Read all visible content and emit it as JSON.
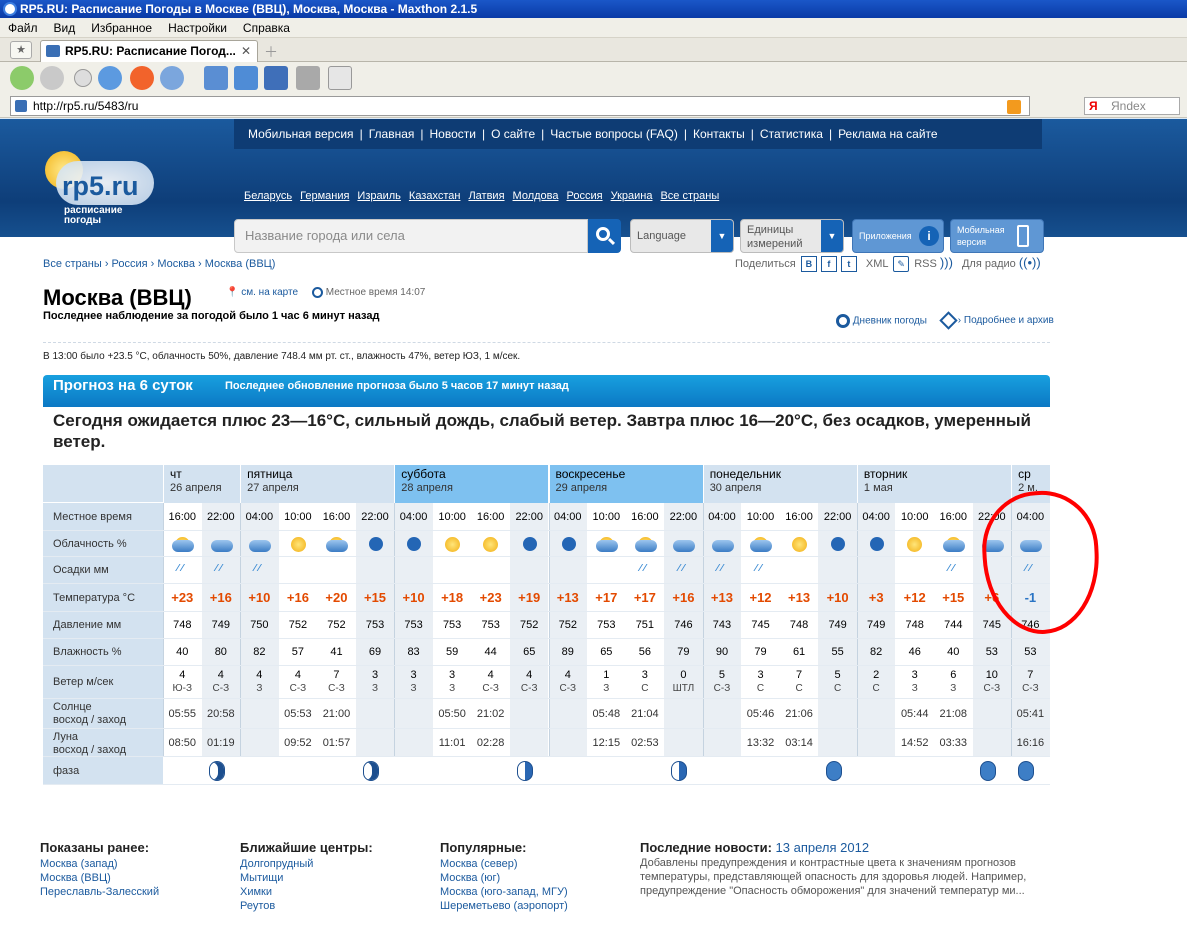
{
  "window_title": "RP5.RU: Расписание Погоды в Москве (ВВЦ), Москва, Москва - Maxthon 2.1.5",
  "menu": [
    "Файл",
    "Вид",
    "Избранное",
    "Настройки",
    "Справка"
  ],
  "tab_title": "RP5.RU: Расписание Погод...",
  "address": "http://rp5.ru/5483/ru",
  "yandex_placeholder": "Яndex",
  "logo": {
    "name": "rp5.ru",
    "sub": "расписание погоды"
  },
  "topnav": [
    "Мобильная версия",
    "Главная",
    "Новости",
    "О сайте",
    "Частые вопросы (FAQ)",
    "Контакты",
    "Статистика",
    "Реклама на сайте"
  ],
  "countries": [
    "Беларусь",
    "Германия",
    "Израиль",
    "Казахстан",
    "Латвия",
    "Молдова",
    "Россия",
    "Украина",
    "Все страны"
  ],
  "search_placeholder": "Название города или села",
  "language_label": "Language",
  "units_label": "Единицы измерений",
  "apps_label": "Приложения",
  "mobile_label": "Мобильная версия",
  "breadcrumb": "Все страны › Россия › Москва › Москва (ВВЦ)",
  "share": {
    "label": "Поделиться",
    "xml": "XML",
    "rss": "RSS",
    "radio": "Для радио"
  },
  "city": "Москва (ВВЦ)",
  "map_link": "см. на карте",
  "local_time": "Местное время  14:07",
  "last_obs": "Последнее наблюдение за погодой было 1 час 6 минут назад",
  "diary": "Дневник погоды",
  "archive": "Подробнее и архив",
  "obs_line": "В 13:00 было +23.5 °C,  облачность 50%,   давление 748.4 мм рт. ст.,    влажность 47%, ветер ЮЗ, 1 м/сек.",
  "forecast": {
    "title": "Прогноз на 6 суток",
    "updated": "Последнее обновление прогноза было 5 часов 17 минут назад",
    "summary": "Сегодня ожидается плюс 23—16°C,  сильный дождь, слабый ветер. Завтра плюс 16—20°C,  без осадков, умеренный ветер."
  },
  "row_labels": {
    "time": "Местное время",
    "cloud": "Облачность %",
    "precip": "Осадки мм",
    "temp": "Температура °C",
    "pressure": "Давление мм",
    "humidity": "Влажность %",
    "wind": "Ветер м/сек",
    "sun": "Солнце\nвосход / заход",
    "moon": "Луна\nвосход / заход",
    "phase": "фаза"
  },
  "days": [
    {
      "name": "чт",
      "date": "26 апреля",
      "highlight": false
    },
    {
      "name": "пятница",
      "date": "27 апреля",
      "highlight": false
    },
    {
      "name": "суббота",
      "date": "28 апреля",
      "highlight": true
    },
    {
      "name": "воскресенье",
      "date": "29 апреля",
      "highlight": true
    },
    {
      "name": "понедельник",
      "date": "30 апреля",
      "highlight": false
    },
    {
      "name": "вторник",
      "date": "1 мая",
      "highlight": false
    },
    {
      "name": "ср",
      "date": "2 м.",
      "highlight": false
    }
  ],
  "columns": [
    {
      "day": 0,
      "time": "16:00",
      "temp": "+23",
      "p": "748",
      "h": "40",
      "w": "4",
      "wd": "Ю-З",
      "sky": "cloud",
      "rain": true,
      "night": false
    },
    {
      "day": 0,
      "time": "22:00",
      "temp": "+16",
      "p": "749",
      "h": "80",
      "w": "4",
      "wd": "С-З",
      "sky": "cloud",
      "rain": true,
      "night": true
    },
    {
      "day": 1,
      "time": "04:00",
      "temp": "+10",
      "p": "750",
      "h": "82",
      "w": "4",
      "wd": "З",
      "sky": "cloud",
      "rain": true,
      "night": true
    },
    {
      "day": 1,
      "time": "10:00",
      "temp": "+16",
      "p": "752",
      "h": "57",
      "w": "4",
      "wd": "С-З",
      "sky": "sun",
      "rain": false,
      "night": false
    },
    {
      "day": 1,
      "time": "16:00",
      "temp": "+20",
      "p": "752",
      "h": "41",
      "w": "7",
      "wd": "С-З",
      "sky": "cloud",
      "rain": false,
      "night": false
    },
    {
      "day": 1,
      "time": "22:00",
      "temp": "+15",
      "p": "753",
      "h": "69",
      "w": "3",
      "wd": "З",
      "sky": "moon",
      "rain": false,
      "night": true
    },
    {
      "day": 2,
      "time": "04:00",
      "temp": "+10",
      "p": "753",
      "h": "83",
      "w": "3",
      "wd": "З",
      "sky": "moon",
      "rain": false,
      "night": true
    },
    {
      "day": 2,
      "time": "10:00",
      "temp": "+18",
      "p": "753",
      "h": "59",
      "w": "3",
      "wd": "З",
      "sky": "sun",
      "rain": false,
      "night": false
    },
    {
      "day": 2,
      "time": "16:00",
      "temp": "+23",
      "p": "753",
      "h": "44",
      "w": "4",
      "wd": "С-З",
      "sky": "sun",
      "rain": false,
      "night": false
    },
    {
      "day": 2,
      "time": "22:00",
      "temp": "+19",
      "p": "752",
      "h": "65",
      "w": "4",
      "wd": "С-З",
      "sky": "moon",
      "rain": false,
      "night": true
    },
    {
      "day": 3,
      "time": "04:00",
      "temp": "+13",
      "p": "752",
      "h": "89",
      "w": "4",
      "wd": "С-З",
      "sky": "moon",
      "rain": false,
      "night": true
    },
    {
      "day": 3,
      "time": "10:00",
      "temp": "+17",
      "p": "753",
      "h": "65",
      "w": "1",
      "wd": "З",
      "sky": "cloud",
      "rain": false,
      "night": false
    },
    {
      "day": 3,
      "time": "16:00",
      "temp": "+17",
      "p": "751",
      "h": "56",
      "w": "3",
      "wd": "С",
      "sky": "cloud",
      "rain": true,
      "night": false
    },
    {
      "day": 3,
      "time": "22:00",
      "temp": "+16",
      "p": "746",
      "h": "79",
      "w": "0",
      "wd": "ШТЛ",
      "sky": "cloud",
      "rain": true,
      "night": true
    },
    {
      "day": 4,
      "time": "04:00",
      "temp": "+13",
      "p": "743",
      "h": "90",
      "w": "5",
      "wd": "С-З",
      "sky": "cloud",
      "rain": true,
      "night": true
    },
    {
      "day": 4,
      "time": "10:00",
      "temp": "+12",
      "p": "745",
      "h": "79",
      "w": "3",
      "wd": "С",
      "sky": "cloud",
      "rain": true,
      "night": false
    },
    {
      "day": 4,
      "time": "16:00",
      "temp": "+13",
      "p": "748",
      "h": "61",
      "w": "7",
      "wd": "С",
      "sky": "sun",
      "rain": false,
      "night": false
    },
    {
      "day": 4,
      "time": "22:00",
      "temp": "+10",
      "p": "749",
      "h": "55",
      "w": "5",
      "wd": "С",
      "sky": "moon",
      "rain": false,
      "night": true
    },
    {
      "day": 5,
      "time": "04:00",
      "temp": "+3",
      "p": "749",
      "h": "82",
      "w": "2",
      "wd": "С",
      "sky": "moon",
      "rain": false,
      "night": true
    },
    {
      "day": 5,
      "time": "10:00",
      "temp": "+12",
      "p": "748",
      "h": "46",
      "w": "3",
      "wd": "З",
      "sky": "sun",
      "rain": false,
      "night": false
    },
    {
      "day": 5,
      "time": "16:00",
      "temp": "+15",
      "p": "744",
      "h": "40",
      "w": "6",
      "wd": "З",
      "sky": "cloud",
      "rain": true,
      "night": false
    },
    {
      "day": 5,
      "time": "22:00",
      "temp": "+6",
      "p": "745",
      "h": "53",
      "w": "10",
      "wd": "С-З",
      "sky": "cloud",
      "rain": false,
      "night": true
    },
    {
      "day": 6,
      "time": "04:00",
      "temp": "-1",
      "p": "746",
      "h": "53",
      "w": "7",
      "wd": "С-З",
      "sky": "cloud",
      "rain": true,
      "night": true
    }
  ],
  "sun": [
    [
      "05:55",
      "20:58"
    ],
    [
      "05:53",
      "21:00"
    ],
    [
      "05:50",
      "21:02"
    ],
    [
      "05:48",
      "21:04"
    ],
    [
      "05:46",
      "21:06"
    ],
    [
      "05:44",
      "21:08"
    ],
    [
      "05:41",
      ""
    ]
  ],
  "moon": [
    [
      "08:50",
      "01:19"
    ],
    [
      "09:52",
      "01:57"
    ],
    [
      "11:01",
      "02:28"
    ],
    [
      "12:15",
      "02:53"
    ],
    [
      "13:32",
      "03:14"
    ],
    [
      "14:52",
      "03:33"
    ],
    [
      "16:16",
      ""
    ]
  ],
  "phases": [
    "waxing-crescent",
    "waxing-crescent",
    "first-quarter",
    "first-quarter",
    "waxing-gibbous",
    "waxing-gibbous",
    "waxing-gibbous"
  ],
  "footer": {
    "shown_title": "Показаны ранее:",
    "shown": [
      "Москва (запад)",
      "Москва (ВВЦ)",
      "Переславль-Залесский"
    ],
    "near_title": "Ближайшие центры:",
    "near": [
      "Долгопрудный",
      "Мытищи",
      "Химки",
      "Реутов"
    ],
    "pop_title": "Популярные:",
    "pop": [
      "Москва (север)",
      "Москва (юг)",
      "Москва (юго-запад, МГУ)",
      "Шереметьево (аэропорт)"
    ],
    "news_title": "Последние новости:",
    "news_date": "13 апреля 2012",
    "news_text": "Добавлены предупреждения и контрастные цвета к значениям прогнозов температуры, представляющей опасность для здоровья людей. Например, предупреждение \"Опасность обморожения\" для значений температур ми..."
  },
  "colors": {
    "accent": "#0b78c4",
    "header": "#1b5a9e",
    "temp": "#e34a00",
    "highlight": "#7ec1f0",
    "annotation": "#ff0000"
  }
}
